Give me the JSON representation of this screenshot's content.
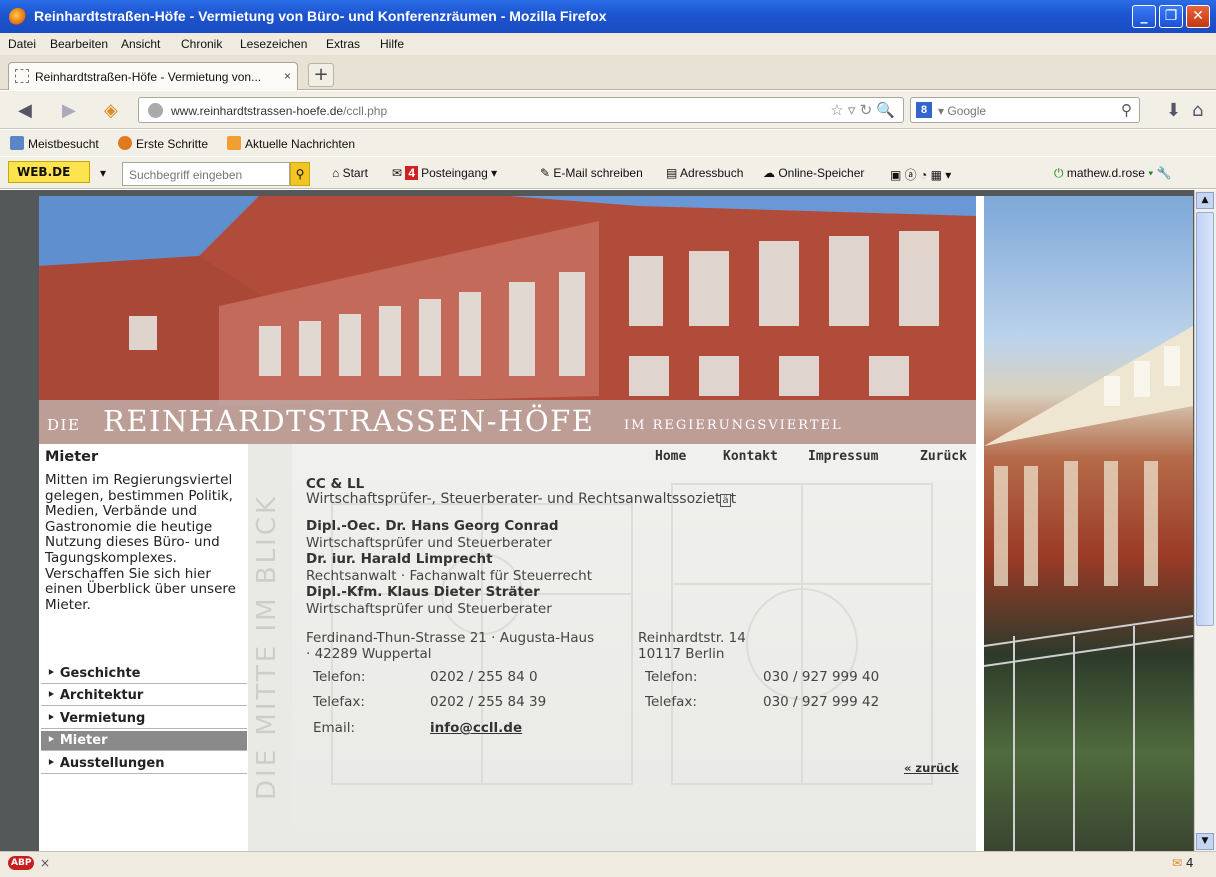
{
  "window": {
    "title": "Reinhardtstraßen-Höfe - Vermietung von Büro- und Konferenzräumen - Mozilla Firefox"
  },
  "menu": [
    "Datei",
    "Bearbeiten",
    "Ansicht",
    "Chronik",
    "Lesezeichen",
    "Extras",
    "Hilfe"
  ],
  "tab": {
    "title": "Reinhardtstraßen-Höfe - Vermietung von...",
    "close": "×",
    "new": "+"
  },
  "url": {
    "domain": "www.reinhardtstrassen-hoefe.de",
    "path": "/ccll.php"
  },
  "search": {
    "placeholder": "Google",
    "engine": "8"
  },
  "bookmarks": [
    "Meistbesucht",
    "Erste Schritte",
    "Aktuelle Nachrichten"
  ],
  "webde": {
    "logo": "WEB.DE",
    "placeholder": "Suchbegriff eingeben",
    "start": "Start",
    "inbox_count": "4",
    "inbox": "Posteingang",
    "compose": "E-Mail schreiben",
    "addressbook": "Adressbuch",
    "storage": "Online-Speicher",
    "user": "mathew.d.rose"
  },
  "banner": {
    "caption_pre": "DIE",
    "caption_main": "REINHARDTSTRASSEN-HÖFE",
    "caption_post": "IM REGIERUNGSVIERTEL"
  },
  "nav": {
    "home": "Home",
    "contact": "Kontakt",
    "imprint": "Impressum",
    "back": "Zurück"
  },
  "sidebar": {
    "title": "Mieter",
    "text": "Mitten im Regierungsviertel gelegen, bestimmen Politik, Medien, Verbände und Gastronomie die heutige Nutzung dieses Büro- und Tagungskomplexes. Verschaffen Sie sich hier einen Überblick über unsere Mieter.",
    "links": [
      "Geschichte",
      "Architektur",
      "Vermietung",
      "Mieter",
      "Ausstellungen"
    ],
    "vertical": "DIE MITTE IM BLICK"
  },
  "tenant": {
    "name": "CC & LL",
    "subtitle": "Wirtschaftsprüfer-, Steuerberater- und Rechtsanwaltssoziet\u0000t",
    "p1_name": "Dipl.-Oec. Dr. Hans Georg Conrad",
    "p1_role": "Wirtschaftsprüfer und Steuerberater",
    "p2_name": "Dr. iur. Harald Limprecht",
    "p2_role": "Rechtsanwalt · Fachanwalt für Steuerrecht",
    "p3_name": "Dipl.-Kfm. Klaus Dieter Sträter",
    "p3_role": "Wirtschaftsprüfer und Steuerberater",
    "addr1_l1": "Ferdinand-Thun-Strasse 21 · Augusta-Haus",
    "addr1_l2": "· 42289 Wuppertal",
    "addr2_l1": "Reinhardtstr. 14",
    "addr2_l2": "10117 Berlin",
    "tel_label": "Telefon:",
    "fax_label": "Telefax:",
    "email_label": "Email:",
    "tel1": "0202 / 255 84 0",
    "fax1": "0202 / 255 84 39",
    "tel2": "030 / 927 999 40",
    "fax2": "030 / 927 999 42",
    "email": "info@ccll.de",
    "back_link": "« zurück"
  },
  "status": {
    "abp": "ABP",
    "close": "×",
    "count": "4"
  }
}
